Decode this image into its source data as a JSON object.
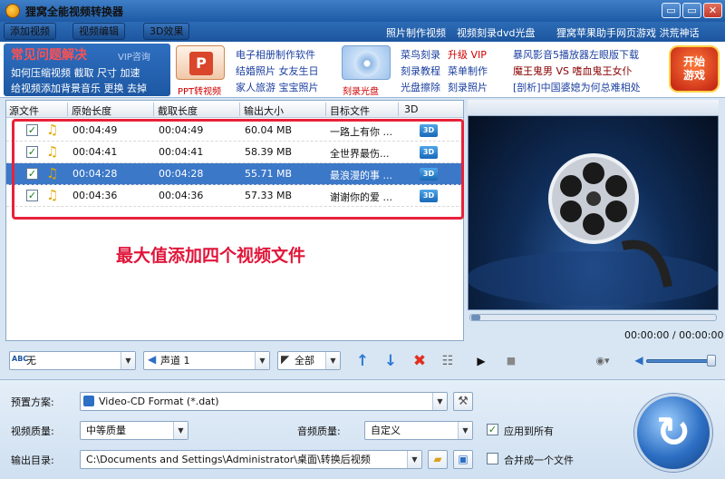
{
  "app": {
    "title": "狸窝全能视频转换器"
  },
  "window": {
    "minimize": "▭",
    "restore": "▭",
    "close": "✕"
  },
  "menu": {
    "buttons": [
      "添加视频",
      "视频编辑",
      "3D效果"
    ],
    "links": [
      "照片制作视频",
      "视频刻录dvd光盘",
      "狸窝苹果助手",
      "网页游戏 洪荒神话"
    ]
  },
  "promo": {
    "faq_title": "常见问题解决",
    "vip": "VIP咨询",
    "faq_lines": [
      "如何压缩视频 截取 尺寸 加速",
      "给视频添加背景音乐 更换 去掉"
    ],
    "ppt_label": "PPT转视频",
    "album_links": [
      "电子相册制作软件",
      "结婚照片 女友生日",
      "家人旅游 宝宝照片"
    ],
    "burn_label": "刻录光盘",
    "burn_links": [
      "菜鸟刻录",
      "升级 VIP",
      "刻录教程",
      "菜单制作",
      "光盘擦除",
      "刻录照片"
    ],
    "news": [
      "暴风影音5播放器左眼版下载",
      "魔王鬼男 VS 嗜血鬼王女仆",
      "[剖析]中国婆媳为何总难相处"
    ],
    "game_label": "开始\n游戏"
  },
  "list": {
    "headers": [
      "源文件",
      "原始长度",
      "截取长度",
      "输出大小",
      "目标文件",
      "3D"
    ],
    "rows": [
      {
        "orig": "00:04:49",
        "cut": "00:04:49",
        "size": "60.04 MB",
        "target": "一路上有你 ...",
        "selected": false
      },
      {
        "orig": "00:04:41",
        "cut": "00:04:41",
        "size": "58.39 MB",
        "target": "全世界最伤...",
        "selected": false
      },
      {
        "orig": "00:04:28",
        "cut": "00:04:28",
        "size": "55.71 MB",
        "target": "最浪漫的事 ...",
        "selected": true
      },
      {
        "orig": "00:04:36",
        "cut": "00:04:36",
        "size": "57.33 MB",
        "target": "谢谢你的爱 ...",
        "selected": false
      }
    ],
    "badge_3d": "3D",
    "annotation": "最大值添加四个视频文件"
  },
  "listbar": {
    "subtitle": "无",
    "audio": "声道 1",
    "clip": "全部"
  },
  "player": {
    "time": "00:00:00 / 00:00:00",
    "volume": 1.0,
    "progress": 0.0
  },
  "settings": {
    "preset_label": "预置方案:",
    "preset_value": "Video-CD Format (*.dat)",
    "vquality_label": "视频质量:",
    "vquality_value": "中等质量",
    "aquality_label": "音频质量:",
    "aquality_value": "自定义",
    "apply_all": "应用到所有",
    "apply_all_checked": true,
    "output_label": "输出目录:",
    "output_value": "C:\\Documents and Settings\\Administrator\\桌面\\转换后视频",
    "merge": "合并成一个文件",
    "merge_checked": false
  },
  "colors": {
    "accent": "#1d56a0",
    "annotation": "#e0163a",
    "selected_row": "#3c78c8"
  }
}
